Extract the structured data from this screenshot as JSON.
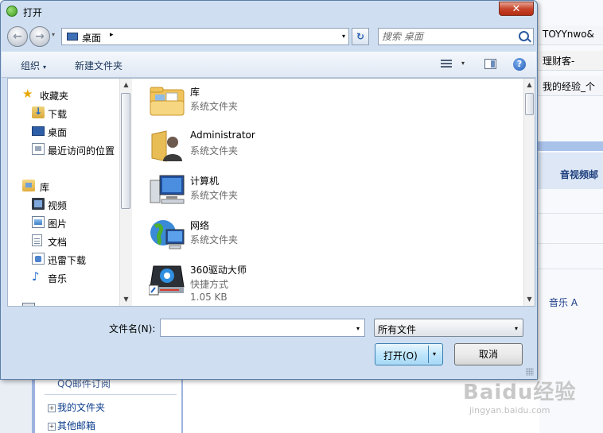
{
  "background_page": {
    "right_tabs": [
      "TOYYnwo&",
      "理财客-",
      "我的经验_个"
    ],
    "section_header": "音视频邮",
    "music_link": "音乐 A",
    "left_panel": {
      "hint": "QQ邮件订阅",
      "items": [
        "我的文件夹",
        "其他邮箱"
      ]
    },
    "watermark": {
      "brand": "Baidu经验",
      "url": "jingyan.baidu.com"
    }
  },
  "dialog": {
    "title": "打开",
    "close_glyph": "✕",
    "address": {
      "crumb": "桌面",
      "crumb_arrow": "▸",
      "dropdown_arrow": "▾"
    },
    "refresh_glyph": "↻",
    "search": {
      "placeholder": "搜索 桌面",
      "icon": "search-icon"
    },
    "toolbar": {
      "organize_label": "组织",
      "organize_arrow": "▾",
      "new_folder_label": "新建文件夹",
      "views_arrow": "▾",
      "help_glyph": "?"
    },
    "nav_pane": {
      "items": [
        {
          "label": "收藏夹",
          "icon": "star-icon",
          "level": 0
        },
        {
          "label": "下载",
          "icon": "download-folder-icon",
          "level": 1
        },
        {
          "label": "桌面",
          "icon": "desktop-icon",
          "level": 1
        },
        {
          "label": "最近访问的位置",
          "icon": "recent-places-icon",
          "level": 1
        },
        {
          "label": "库",
          "icon": "library-icon",
          "level": 0
        },
        {
          "label": "视频",
          "icon": "video-icon",
          "level": 1
        },
        {
          "label": "图片",
          "icon": "picture-icon",
          "level": 1
        },
        {
          "label": "文档",
          "icon": "document-icon",
          "level": 1
        },
        {
          "label": "迅雷下载",
          "icon": "xunlei-download-icon",
          "level": 1
        },
        {
          "label": "音乐",
          "icon": "music-icon",
          "level": 1
        }
      ]
    },
    "files": [
      {
        "name": "库",
        "type": "系统文件夹",
        "icon": "library-folder-icon"
      },
      {
        "name": "Administrator",
        "type": "系统文件夹",
        "icon": "user-folder-icon"
      },
      {
        "name": "计算机",
        "type": "系统文件夹",
        "icon": "computer-icon"
      },
      {
        "name": "网络",
        "type": "系统文件夹",
        "icon": "network-icon"
      },
      {
        "name": "360驱动大师",
        "type": "快捷方式",
        "size": "1.05 KB",
        "icon": "driver-master-shortcut-icon"
      }
    ],
    "filename": {
      "label": "文件名(N):",
      "value": "",
      "dropdown_arrow": "▾"
    },
    "filetype": {
      "selected": "所有文件",
      "dropdown_arrow": "▾"
    },
    "open_button": {
      "label": "打开(O)",
      "arrow": "▾"
    },
    "cancel_button": {
      "label": "取消"
    },
    "colors": {
      "frame": "#cfdff1",
      "close_button": "#c7452b",
      "open_button": "#bee6fd"
    }
  }
}
